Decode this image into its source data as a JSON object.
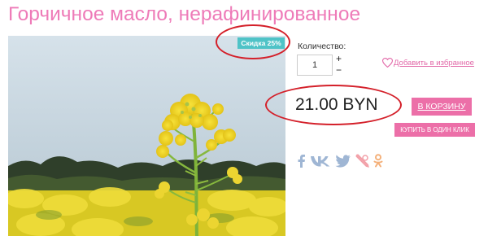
{
  "product": {
    "title": "Горчичное масло, нерафинированное",
    "discount_badge": "Скидка 25%",
    "image_icon": "rapeseed-flower-photo"
  },
  "purchase": {
    "quantity_label": "Количество:",
    "quantity_value": "1",
    "plus_symbol": "+",
    "minus_symbol": "−",
    "wishlist_label": "Добавить в избранное",
    "price": "21.00 BYN",
    "cart_button": "В КОРЗИНУ",
    "one_click_button": "КУПИТЬ В ОДИН КЛИК"
  },
  "social": [
    "facebook-icon",
    "vk-icon",
    "twitter-icon",
    "livejournal-icon",
    "odnoklassniki-icon"
  ],
  "colors": {
    "title": "#ee7bb8",
    "button": "#ec6fa8",
    "badge": "#4fc3c7",
    "annotation": "#d4202a",
    "social": "#9fb6d4"
  }
}
